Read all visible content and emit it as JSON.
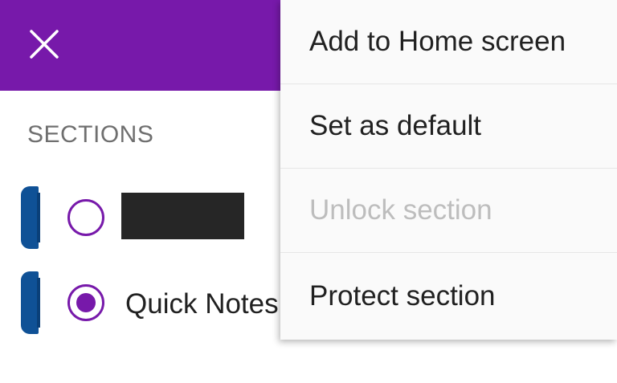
{
  "app_bar": {
    "color": "#7719aa",
    "close_icon": "close-icon"
  },
  "sections": {
    "header": "SECTIONS",
    "items": [
      {
        "name": "",
        "redacted": true,
        "selected": false,
        "tab_color": "#0f5196"
      },
      {
        "name": "Quick Notes",
        "redacted": false,
        "selected": true,
        "tab_color": "#0f5196"
      }
    ]
  },
  "menu": {
    "items": [
      {
        "label": "Add to Home screen",
        "enabled": true
      },
      {
        "label": "Set as default",
        "enabled": true
      },
      {
        "label": "Unlock section",
        "enabled": false
      },
      {
        "label": "Protect section",
        "enabled": true
      }
    ]
  }
}
